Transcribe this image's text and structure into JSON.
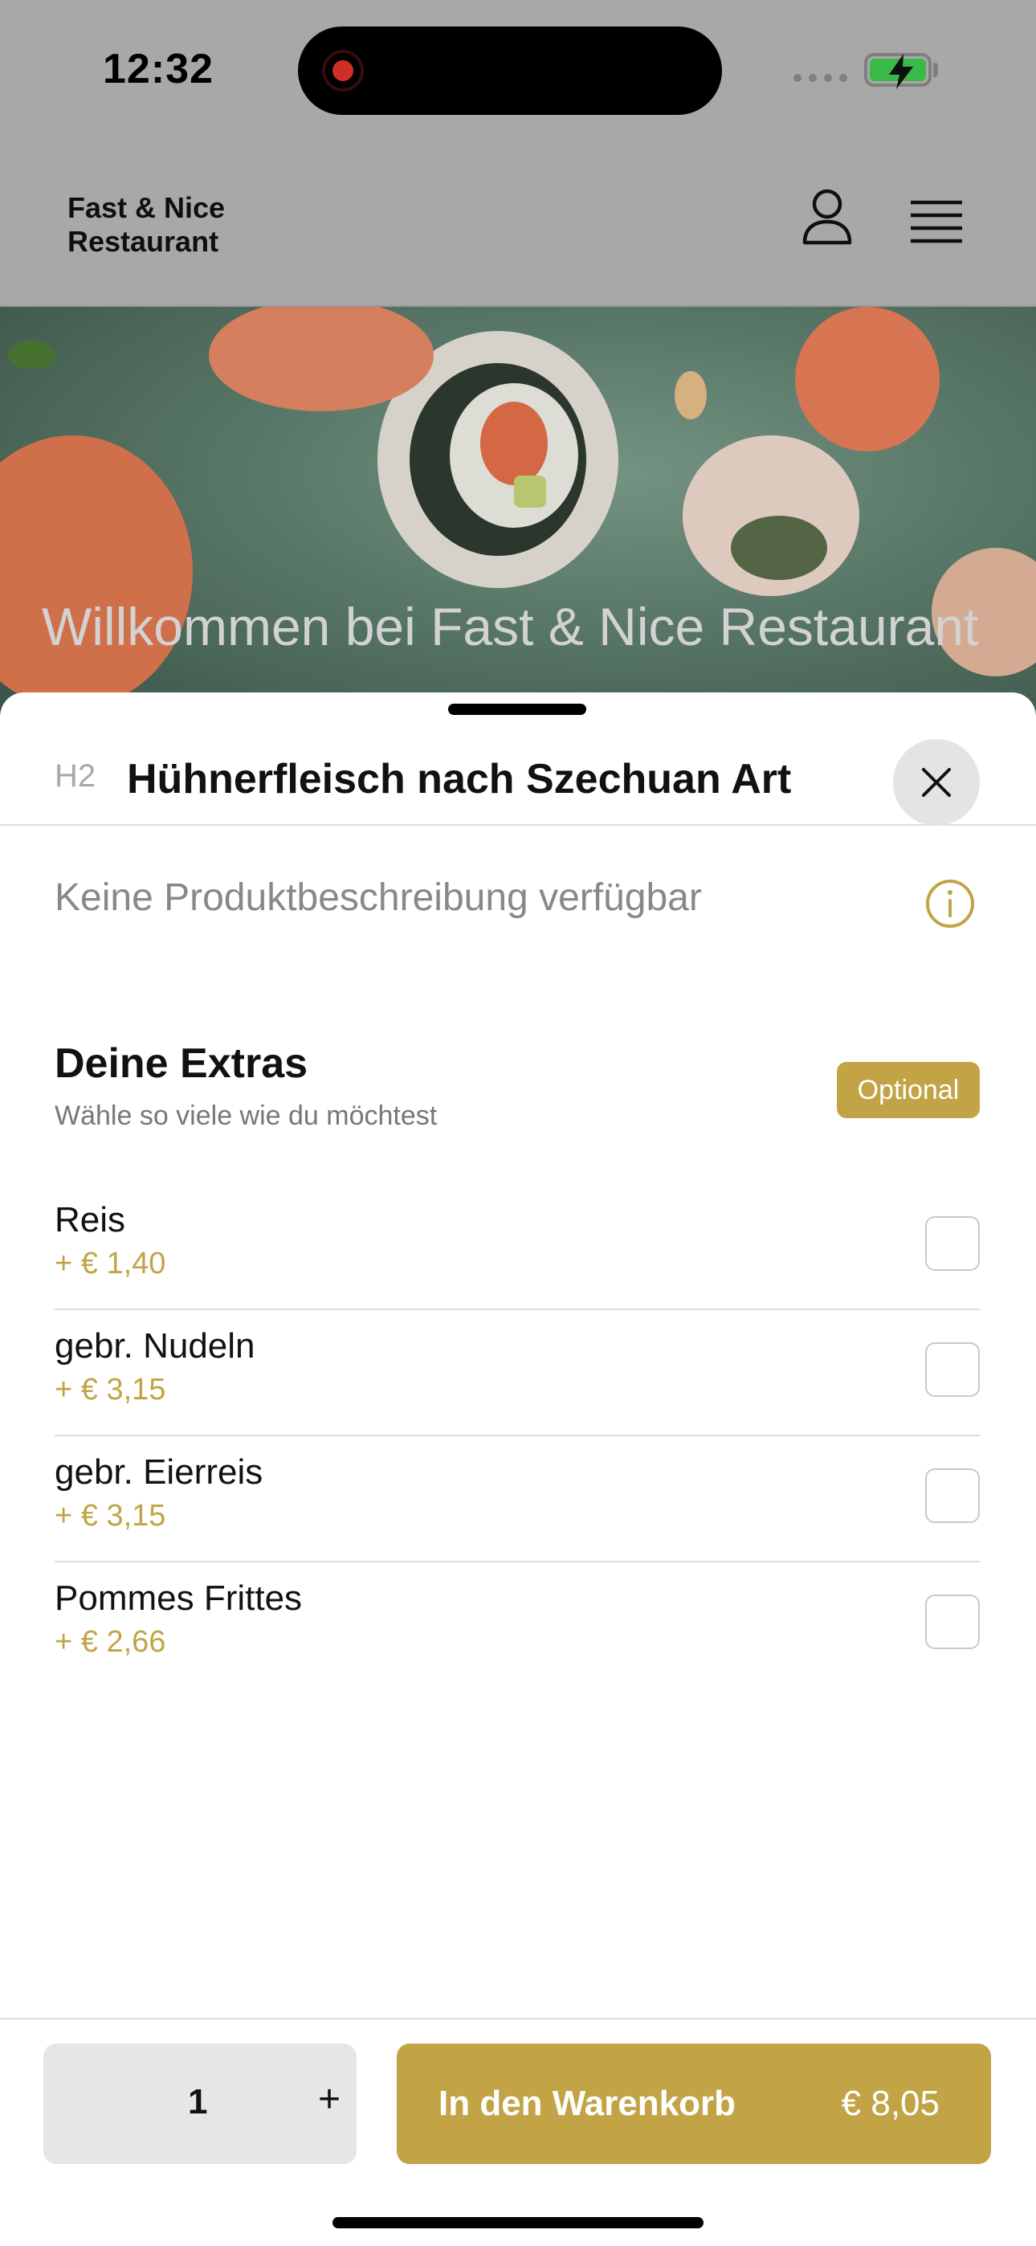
{
  "status_bar": {
    "time": "12:32",
    "recording_icon": "record-dot-icon",
    "battery_icon": "battery-charging-icon"
  },
  "header": {
    "restaurant_name": "Fast & Nice\nRestaurant",
    "account_icon": "user-icon",
    "menu_icon": "hamburger-menu-icon"
  },
  "hero": {
    "title": "Willkommen bei Fast & Nice Restaurant"
  },
  "sheet": {
    "heading_tag": "H2",
    "title": "Hühnerfleisch nach Szechuan Art",
    "close_icon": "close-icon",
    "description": "Keine Produktbeschreibung verfügbar",
    "info_icon": "info-icon",
    "extras": {
      "title": "Deine Extras",
      "subtitle": "Wähle so viele wie du möchtest",
      "badge": "Optional",
      "items": [
        {
          "name": "Reis",
          "price": "+ € 1,40",
          "checked": false
        },
        {
          "name": "gebr. Nudeln",
          "price": "+ € 3,15",
          "checked": false
        },
        {
          "name": "gebr. Eierreis",
          "price": "+ € 3,15",
          "checked": false
        },
        {
          "name": "Pommes Frittes",
          "price": "+ € 2,66",
          "checked": false
        }
      ]
    }
  },
  "footer": {
    "quantity": "1",
    "plus": "+",
    "cart_label": "In den Warenkorb",
    "cart_price": "€ 8,05"
  },
  "colors": {
    "accent": "#c2a446",
    "header_bg": "#b7b7b7",
    "button_gray": "#e6e6e6"
  }
}
